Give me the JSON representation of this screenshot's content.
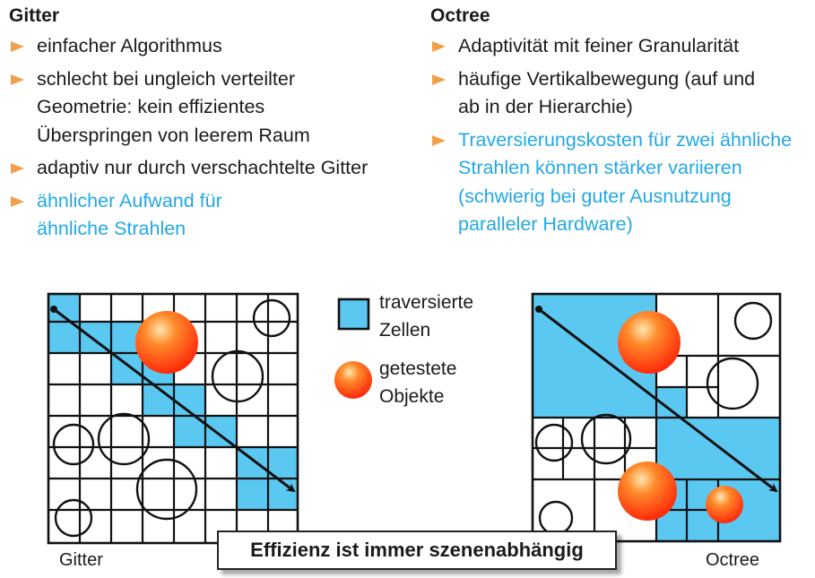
{
  "left_column": {
    "title": "Gitter",
    "bullets": [
      {
        "text": "einfacher Algorithmus",
        "color": "#1a1a1a"
      },
      {
        "text": "schlecht bei ungleich verteilter Geometrie: kein effizientes Überspringen von leerem Raum",
        "color": "#1a1a1a"
      },
      {
        "text": "adaptiv nur durch verschachtelte Gitter",
        "color": "#1a1a1a"
      },
      {
        "text": "ähnlicher Aufwand für ähnliche Strahlen",
        "color": "#22a8e4"
      }
    ]
  },
  "right_column": {
    "title": "Octree",
    "bullets": [
      {
        "text": "Adaptivität mit feiner Granularität",
        "color": "#1a1a1a"
      },
      {
        "text": "häufige Vertikalbewegung (auf und ab in der Hierarchie)",
        "color": "#1a1a1a"
      },
      {
        "text": "Traversierungskosten für zwei ähnliche Strahlen können stärker variieren (schwierig bei guter Ausnutzung paralleler Hardware)",
        "color": "#22a8e4"
      }
    ]
  },
  "legend": {
    "traversed_cells_line1": "traversierte",
    "traversed_cells_line2": "Zellen",
    "tested_objects_line1": "getestete",
    "tested_objects_line2": "Objekte"
  },
  "captions": {
    "grid": "Gitter",
    "octree": "Octree"
  },
  "banner": "Effizienz ist immer szenenabhängig",
  "colors": {
    "bullet_orange": "#f0a04b",
    "highlight_blue": "#22a8e4",
    "cell_fill": "#5bc8f2",
    "sphere_orange": "#ff5a1a"
  }
}
